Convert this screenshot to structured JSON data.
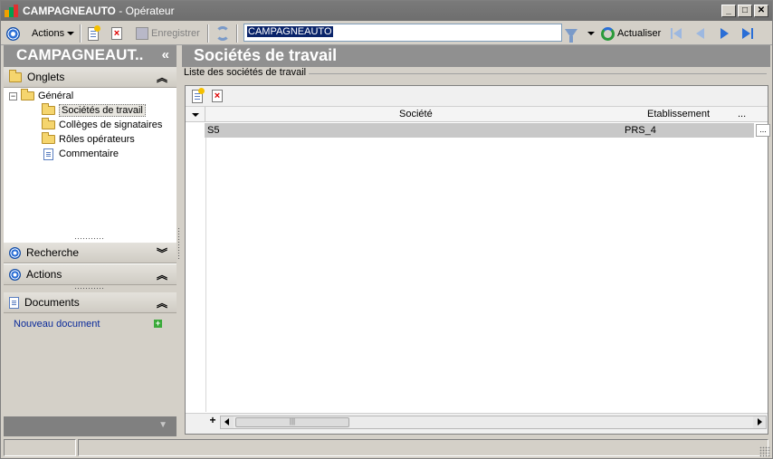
{
  "window": {
    "app_name": "CAMPAGNEAUTO",
    "separator": " - ",
    "subtitle": "Opérateur",
    "min": "_",
    "max": "□",
    "close": "✕"
  },
  "toolbar": {
    "actions_label": "Actions",
    "save_label": "Enregistrer",
    "search_value": "CAMPAGNEAUTO",
    "refresh_label": "Actualiser"
  },
  "left": {
    "header_title": "CAMPAGNEAUT..",
    "collapse_glyph": "«",
    "onglets_label": "Onglets",
    "onglets_chevron": "︽",
    "tree": {
      "root_expander": "−",
      "root_label": "Général",
      "items": [
        "Sociétés de travail",
        "Collèges de signataires",
        "Rôles opérateurs",
        "Commentaire"
      ]
    },
    "recherche_label": "Recherche",
    "recherche_chevron": "︾",
    "actions_label": "Actions",
    "actions_chevron": "︽",
    "documents_label": "Documents",
    "documents_chevron": "︽",
    "new_document_label": "Nouveau document",
    "add_glyph": "+",
    "footer_arrow": "▼"
  },
  "main": {
    "title": "Sociétés de travail",
    "list_caption": "Liste des sociétés de travail",
    "columns": {
      "societe": "Société",
      "etablissement": "Etablissement",
      "more": "..."
    },
    "rows": [
      {
        "societe": "S5",
        "etablissement": "PRS_4",
        "more": "..."
      }
    ],
    "add_row_glyph": "+",
    "scroll_thumb": "|||"
  },
  "colors": {
    "header_gray": "#909090",
    "accent_blue": "#2a6ed6",
    "selection": "#0a246a"
  },
  "icons": [
    "app-logo-icon",
    "circle-target-icon",
    "new-document-icon",
    "delete-icon",
    "save-icon",
    "refresh-icon",
    "filter-icon",
    "reload-icon",
    "first-icon",
    "previous-icon",
    "next-icon",
    "last-icon",
    "folder-icon",
    "document-icon"
  ]
}
